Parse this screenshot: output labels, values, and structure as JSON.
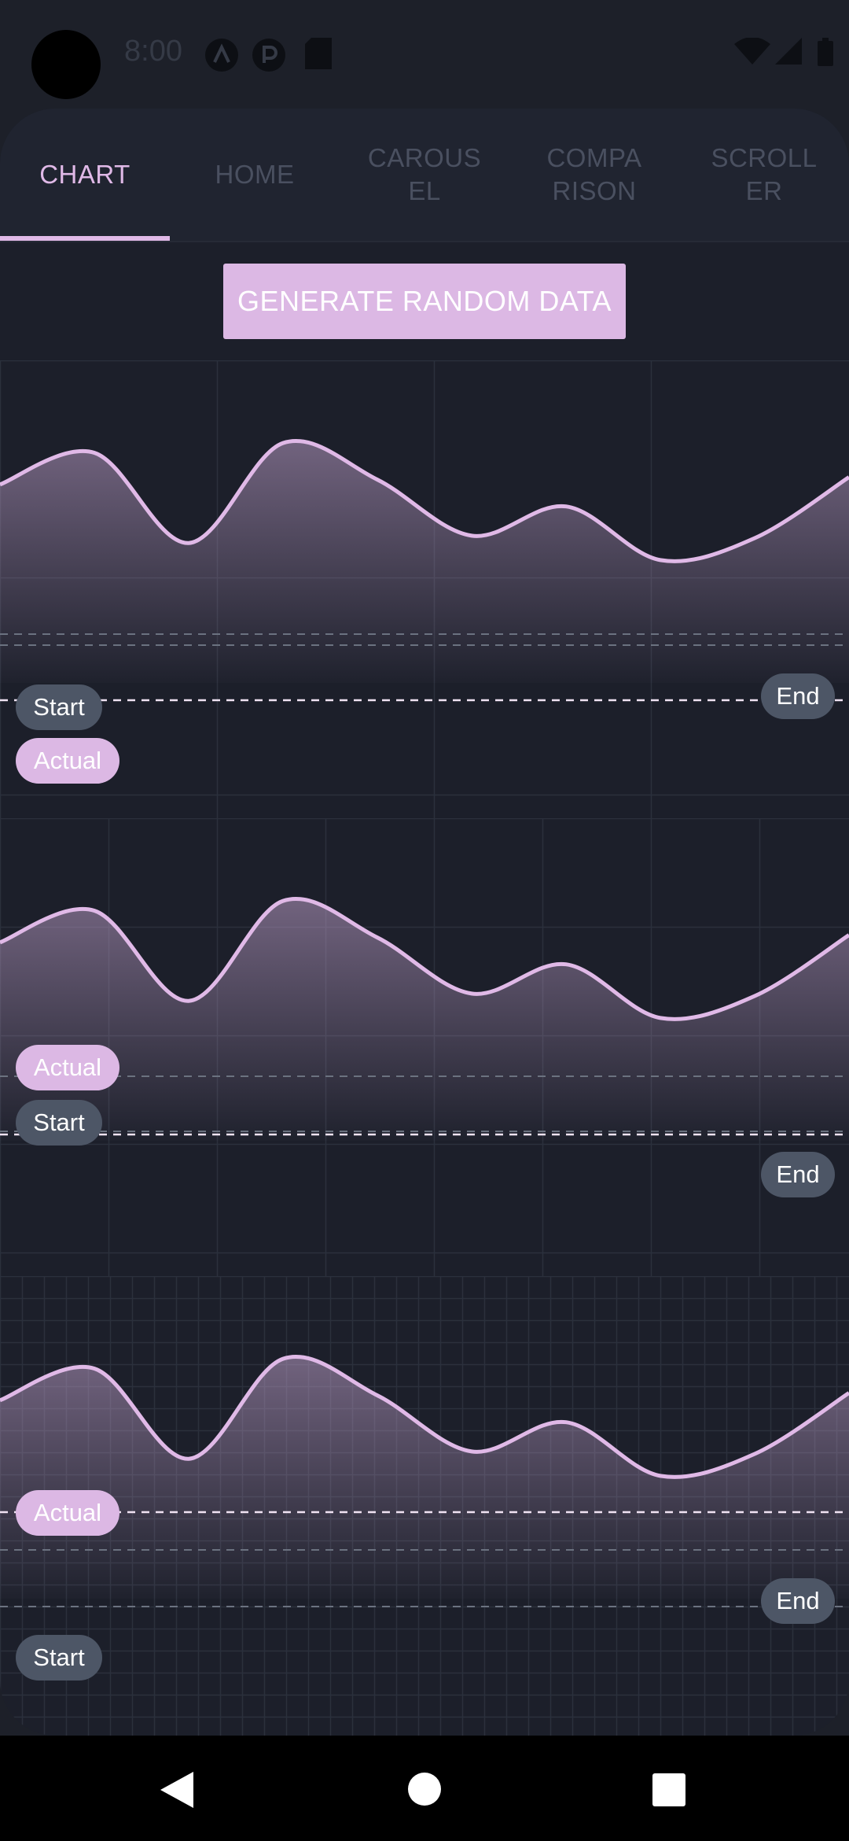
{
  "status_bar": {
    "time": "8:00",
    "left_icons": [
      "notification-a-icon",
      "notification-p-icon",
      "sd-card-icon"
    ],
    "right_icons": [
      "wifi-icon",
      "cellular-signal-icon",
      "battery-icon"
    ]
  },
  "tabs": [
    {
      "label": "CHART",
      "active": true
    },
    {
      "label": "HOME",
      "active": false
    },
    {
      "label": "CAROUS\nEL",
      "active": false
    },
    {
      "label": "COMPA\nRISON",
      "active": false
    },
    {
      "label": "SCROLL\nER",
      "active": false
    }
  ],
  "generate_button": {
    "label": "GENERATE RANDOM DATA"
  },
  "colors": {
    "accent": "#e0b9e7",
    "pill_dark": "#4d5666",
    "background": "#1c1f2a",
    "grid": "#2b303c"
  },
  "chart_data": [
    {
      "type": "area",
      "points": [
        0.38,
        0.25,
        0.62,
        0.21,
        0.36,
        0.59,
        0.47,
        0.69,
        0.6,
        0.35
      ],
      "markers": {
        "start": "Start",
        "end": "End",
        "actual": "Actual"
      },
      "grid": "coarse"
    },
    {
      "type": "area",
      "points": [
        0.38,
        0.25,
        0.62,
        0.21,
        0.36,
        0.59,
        0.47,
        0.69,
        0.6,
        0.35
      ],
      "markers": {
        "start": "Start",
        "end": "End",
        "actual": "Actual"
      },
      "grid": "medium"
    },
    {
      "type": "area",
      "points": [
        0.38,
        0.25,
        0.62,
        0.21,
        0.36,
        0.59,
        0.47,
        0.69,
        0.6,
        0.35
      ],
      "markers": {
        "start": "Start",
        "end": "End",
        "actual": "Actual"
      },
      "grid": "fine"
    }
  ],
  "nav_bar": {
    "icons": [
      "back-icon",
      "home-icon",
      "recents-icon"
    ]
  }
}
